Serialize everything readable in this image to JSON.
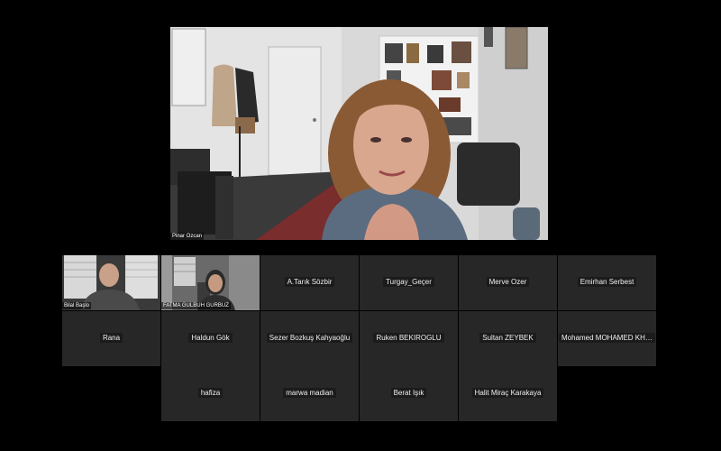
{
  "speaker": {
    "name": "Pinar Ozcan"
  },
  "video_participants": [
    {
      "name": "Bilal Başlo"
    },
    {
      "name": "FATMA GULBUH GURBUZ"
    }
  ],
  "participants": [
    "A.Tarık Sözbir",
    "Turgay_Geçer",
    "Merve Ozer",
    "Emirhan Serbest",
    "Rana",
    "Haldun Gök",
    "Sezer Bozkuş Kahyaoğlu",
    "Ruken BEKIROGLU",
    "Sultan ZEYBEK",
    "Mohamed MOHAMED KHO...",
    "hafiza",
    "marwa madian",
    "Berat Işık",
    "Halit Miraç Karakaya"
  ],
  "colors": {
    "background": "#000000",
    "tile": "#272727",
    "label_bg": "#1b1b1b"
  }
}
